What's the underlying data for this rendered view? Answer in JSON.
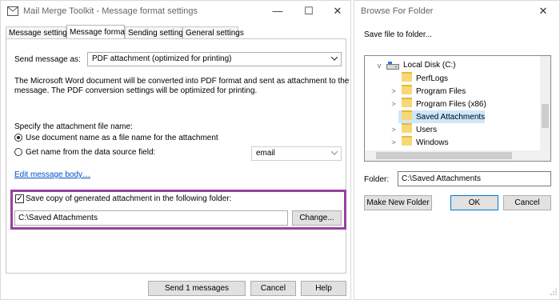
{
  "left_window": {
    "title": "Mail Merge Toolkit - Message format settings",
    "tabs": [
      {
        "label": "Message settings"
      },
      {
        "label": "Message format"
      },
      {
        "label": "Sending settings"
      },
      {
        "label": "General settings"
      }
    ],
    "send_as_label": "Send message as:",
    "send_as_value": "PDF attachment (optimized for printing)",
    "description_line1": "The Microsoft Word document will be converted into PDF format and sent as attachment to the",
    "description_line2": "message. The PDF conversion settings will be optimized for printing.",
    "attachment_name_label": "Specify the attachment file name:",
    "radio_document_name": "Use document name as a file name for the attachment",
    "radio_data_source": "Get name from the data source field:",
    "data_source_field_value": "email",
    "edit_body_link": "Edit message body…",
    "save_copy_label": "Save copy of generated attachment in the following folder:",
    "folder_path": "C:\\Saved Attachments",
    "change_button": "Change...",
    "send_button": "Send 1 messages",
    "cancel_button": "Cancel",
    "help_button": "Help"
  },
  "right_window": {
    "title": "Browse For Folder",
    "instruction": "Save file to folder...",
    "tree": [
      {
        "label": "Local Disk (C:)",
        "type": "drive",
        "expander": "v"
      },
      {
        "label": "PerfLogs",
        "type": "folder",
        "expander": ""
      },
      {
        "label": "Program Files",
        "type": "folder",
        "expander": ">"
      },
      {
        "label": "Program Files (x86)",
        "type": "folder",
        "expander": ">"
      },
      {
        "label": "Saved Attachments",
        "type": "folder",
        "expander": "",
        "selected": true
      },
      {
        "label": "Users",
        "type": "folder",
        "expander": ">"
      },
      {
        "label": "Windows",
        "type": "folder",
        "expander": ">"
      }
    ],
    "folder_label": "Folder:",
    "folder_value": "C:\\Saved Attachments",
    "make_new_folder_button": "Make New Folder",
    "ok_button": "OK",
    "cancel_button": "Cancel"
  },
  "colors": {
    "highlight_border": "#96419f",
    "link": "#0050c8",
    "selection": "#cce8ff",
    "folder": "#f8d775"
  },
  "icons": [
    "app-icon",
    "minimize-icon",
    "maximize-icon",
    "close-icon",
    "chevron-down-icon",
    "drive-icon",
    "folder-icon",
    "expand-arrow-icon"
  ]
}
